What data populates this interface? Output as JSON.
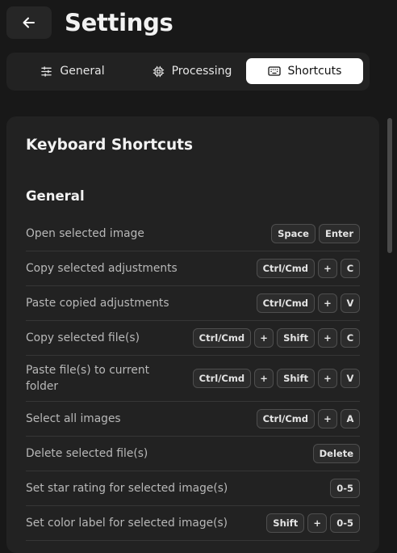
{
  "header": {
    "title": "Settings"
  },
  "tabs": [
    {
      "label": "General",
      "icon": "sliders-icon"
    },
    {
      "label": "Processing",
      "icon": "cpu-icon"
    },
    {
      "label": "Shortcuts",
      "icon": "keyboard-icon",
      "active": true
    }
  ],
  "panel": {
    "title": "Keyboard Shortcuts",
    "section": "General",
    "shortcuts": [
      {
        "label": "Open selected image",
        "keys": [
          "Space",
          "Enter"
        ]
      },
      {
        "label": "Copy selected adjustments",
        "keys": [
          "Ctrl/Cmd",
          "+",
          "C"
        ]
      },
      {
        "label": "Paste copied adjustments",
        "keys": [
          "Ctrl/Cmd",
          "+",
          "V"
        ]
      },
      {
        "label": "Copy selected file(s)",
        "keys": [
          "Ctrl/Cmd",
          "+",
          "Shift",
          "+",
          "C"
        ]
      },
      {
        "label": "Paste file(s) to current folder",
        "keys": [
          "Ctrl/Cmd",
          "+",
          "Shift",
          "+",
          "V"
        ]
      },
      {
        "label": "Select all images",
        "keys": [
          "Ctrl/Cmd",
          "+",
          "A"
        ]
      },
      {
        "label": "Delete selected file(s)",
        "keys": [
          "Delete"
        ]
      },
      {
        "label": "Set star rating for selected image(s)",
        "keys": [
          "0-5"
        ]
      },
      {
        "label": "Set color label for selected image(s)",
        "keys": [
          "Shift",
          "+",
          "0-5"
        ]
      }
    ]
  },
  "colors": {
    "background": "#181818",
    "panel": "#222222",
    "active_tab": "#ffffff",
    "muted_text": "#b8b8b8"
  }
}
